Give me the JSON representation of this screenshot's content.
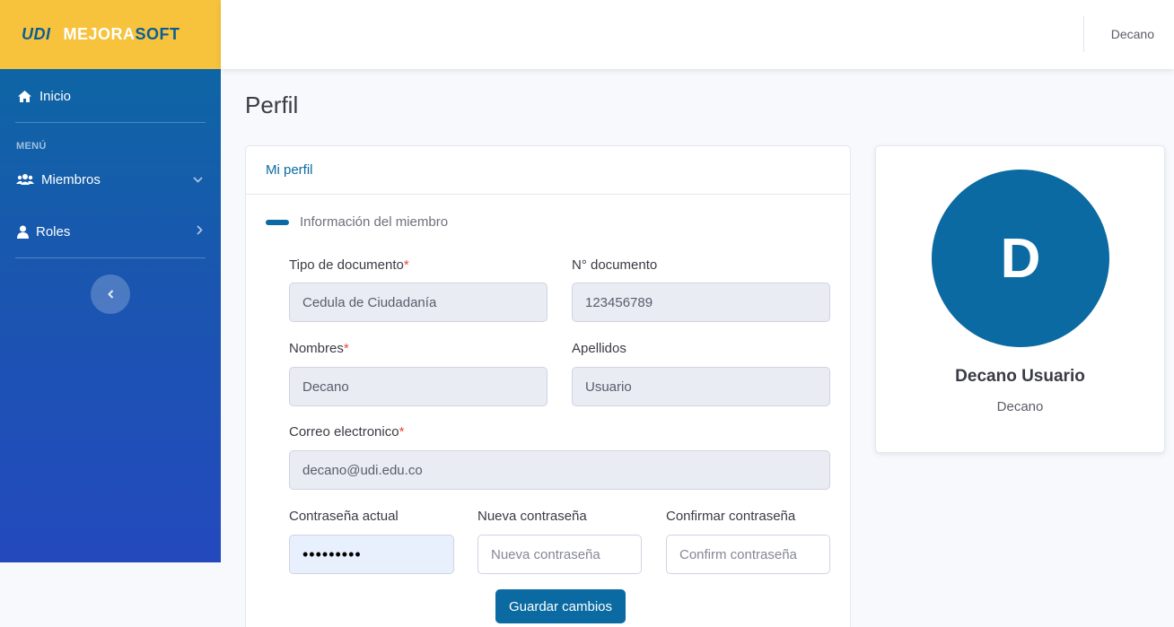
{
  "brand": {
    "logo": "UDI",
    "name_part1": "MEJORA",
    "name_part2": "SOFT"
  },
  "sidebar": {
    "home_label": "Inicio",
    "heading": "MENÚ",
    "items": [
      {
        "label": "Miembros",
        "icon": "users-icon",
        "chevron": "⌄"
      },
      {
        "label": "Roles",
        "icon": "user-icon",
        "chevron": "›"
      }
    ],
    "toggle_icon": "‹"
  },
  "topbar": {
    "user": "Decano"
  },
  "page": {
    "title": "Perfil"
  },
  "card": {
    "header": "Mi perfil",
    "section": "Información del miembro",
    "fields": {
      "tipo_doc": {
        "label": "Tipo de documento",
        "value": "Cedula de Ciudadanía"
      },
      "num_doc": {
        "label": "N° documento",
        "value": "123456789"
      },
      "nombres": {
        "label": "Nombres",
        "value": "Decano"
      },
      "apellidos": {
        "label": "Apellidos",
        "value": "Usuario"
      },
      "correo": {
        "label": "Correo electronico",
        "value": "decano@udi.edu.co"
      },
      "pass_actual": {
        "label": "Contraseña actual",
        "value": "•••••••••"
      },
      "pass_nueva": {
        "label": "Nueva contraseña",
        "placeholder": "Nueva contraseña"
      },
      "pass_confirm": {
        "label": "Confirmar contraseña",
        "placeholder": "Confirm contraseña"
      }
    },
    "required_mark": "*",
    "save_button": "Guardar cambios"
  },
  "profile": {
    "initial": "D",
    "name": "Decano Usuario",
    "role": "Decano"
  },
  "colors": {
    "primary": "#0a6aa1",
    "brand_yellow": "#f7c23c",
    "required": "#e74a3b"
  }
}
